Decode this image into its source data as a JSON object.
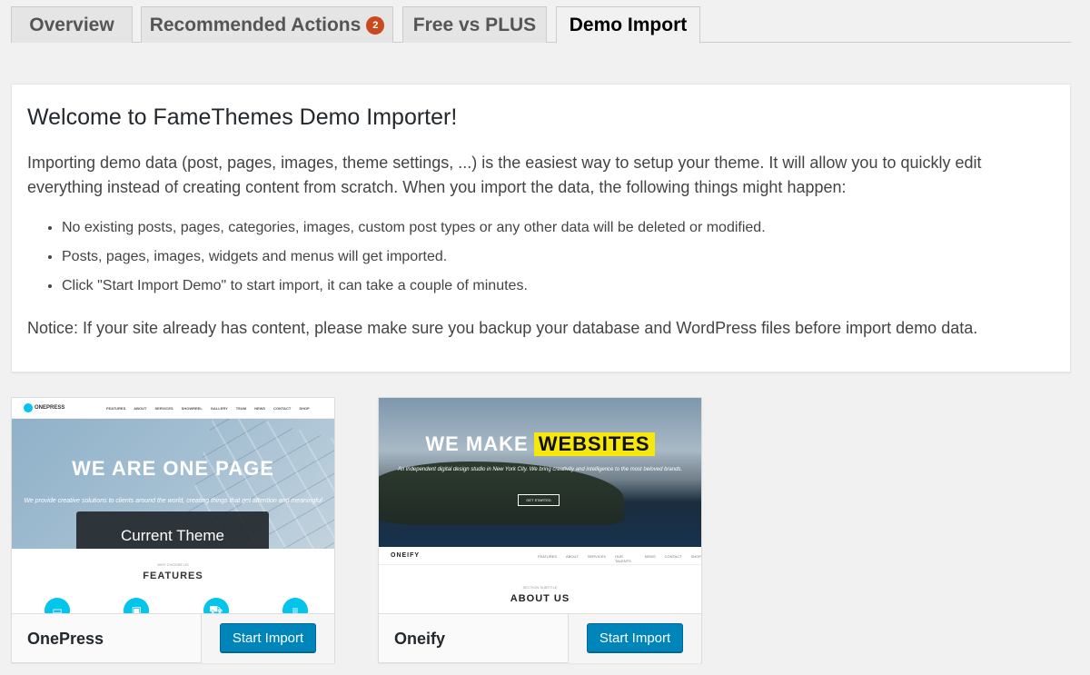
{
  "tabs": [
    {
      "label": "Overview"
    },
    {
      "label": "Recommended Actions",
      "badge": "2"
    },
    {
      "label": "Free vs PLUS"
    },
    {
      "label": "Demo Import",
      "active": true
    }
  ],
  "intro": {
    "title": "Welcome to FameThemes Demo Importer!",
    "description": "Importing demo data (post, pages, images, theme settings, ...) is the easiest way to setup your theme. It will allow you to quickly edit everything instead of creating content from scratch. When you import the data, the following things might happen:",
    "bullets": [
      "No existing posts, pages, categories, images, custom post types or any other data will be deleted or modified.",
      "Posts, pages, images, widgets and menus will get imported.",
      "Click \"Start Import Demo\" to start import, it can take a couple of minutes."
    ],
    "notice": "Notice: If your site already has content, please make sure you backup your database and WordPress files before import demo data."
  },
  "themes": [
    {
      "name": "OnePress",
      "button": "Start Import",
      "overlay": "Current Theme",
      "preview": {
        "logo": "ONEPRESS",
        "menu": [
          "FEATURES",
          "ABOUT",
          "SERVICES",
          "SHOWREEL",
          "GALLERY",
          "TEAM",
          "NEWS",
          "CONTACT",
          "SHOP"
        ],
        "hero_title": "WE ARE ONE PAGE",
        "hero_sub": "We provide creative solutions to clients around the world, creating things that get attention and meaningful",
        "section_sub": "WHY CHOOSE US",
        "section_title": "FEATURES"
      }
    },
    {
      "name": "Oneify",
      "button": "Start Import",
      "preview": {
        "hero_title_a": "WE MAKE",
        "hero_title_b": "WEBSITES",
        "hero_sub": "An independent digital design studio in New York City. We bring creativity and intelligence to the most beloved brands.",
        "hero_button": "GET STARTED",
        "logo": "ONEIFY",
        "menu": [
          "FEATURES",
          "ABOUT",
          "SERVICES",
          "OUR TALENTS",
          "NEWS",
          "CONTACT",
          "SHOP"
        ],
        "section_sub": "SECTION SUBTITLE",
        "section_title": "ABOUT US"
      }
    }
  ]
}
